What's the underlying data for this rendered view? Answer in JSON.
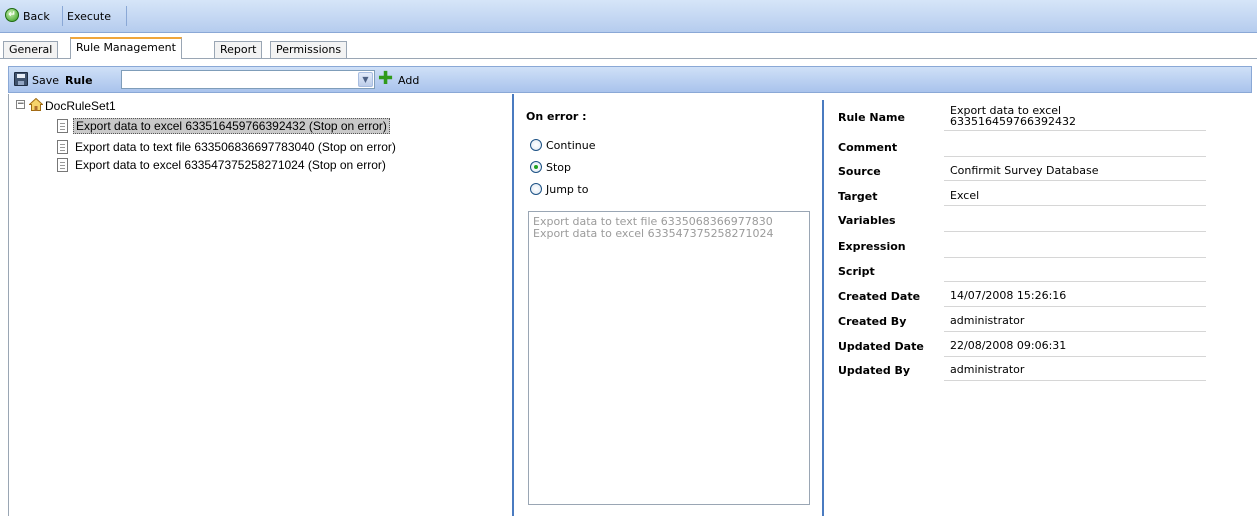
{
  "topbar": {
    "back_label": "Back",
    "execute_label": "Execute"
  },
  "tabs": [
    {
      "label": "General"
    },
    {
      "label": "Rule Management"
    },
    {
      "label": "Report"
    },
    {
      "label": "Permissions"
    }
  ],
  "rulebar": {
    "save_label": "Save",
    "rule_label": "Rule",
    "rule_value": "",
    "add_label": "Add"
  },
  "tree": {
    "root": "DocRuleSet1",
    "items": [
      {
        "label": "Export data to excel 633516459766392432 (Stop on error)",
        "selected": true
      },
      {
        "label": "Export data to text file 633506836697783040 (Stop on error)",
        "selected": false
      },
      {
        "label": "Export data to excel 633547375258271024 (Stop on error)",
        "selected": false
      }
    ]
  },
  "on_error": {
    "title": "On error :",
    "options": [
      {
        "label": "Continue",
        "checked": false
      },
      {
        "label": "Stop",
        "checked": true
      },
      {
        "label": "Jump to",
        "checked": false
      }
    ],
    "jump_list": [
      "Export data to text file 6335068366977830",
      "Export data to excel 633547375258271024"
    ]
  },
  "details": {
    "rule_name_label": "Rule Name",
    "rule_name_line1": "Export data to excel",
    "rule_name_line2": "633516459766392432",
    "comment_label": "Comment",
    "comment_value": "",
    "source_label": "Source",
    "source_value": "Confirmit Survey Database",
    "target_label": "Target",
    "target_value": "Excel",
    "variables_label": "Variables",
    "variables_value": "",
    "expression_label": "Expression",
    "expression_value": "",
    "script_label": "Script",
    "script_value": "",
    "created_date_label": "Created Date",
    "created_date_value": "14/07/2008 15:26:16",
    "created_by_label": "Created By",
    "created_by_value": "administrator",
    "updated_date_label": "Updated Date",
    "updated_date_value": "22/08/2008 09:06:31",
    "updated_by_label": "Updated By",
    "updated_by_value": "administrator"
  }
}
